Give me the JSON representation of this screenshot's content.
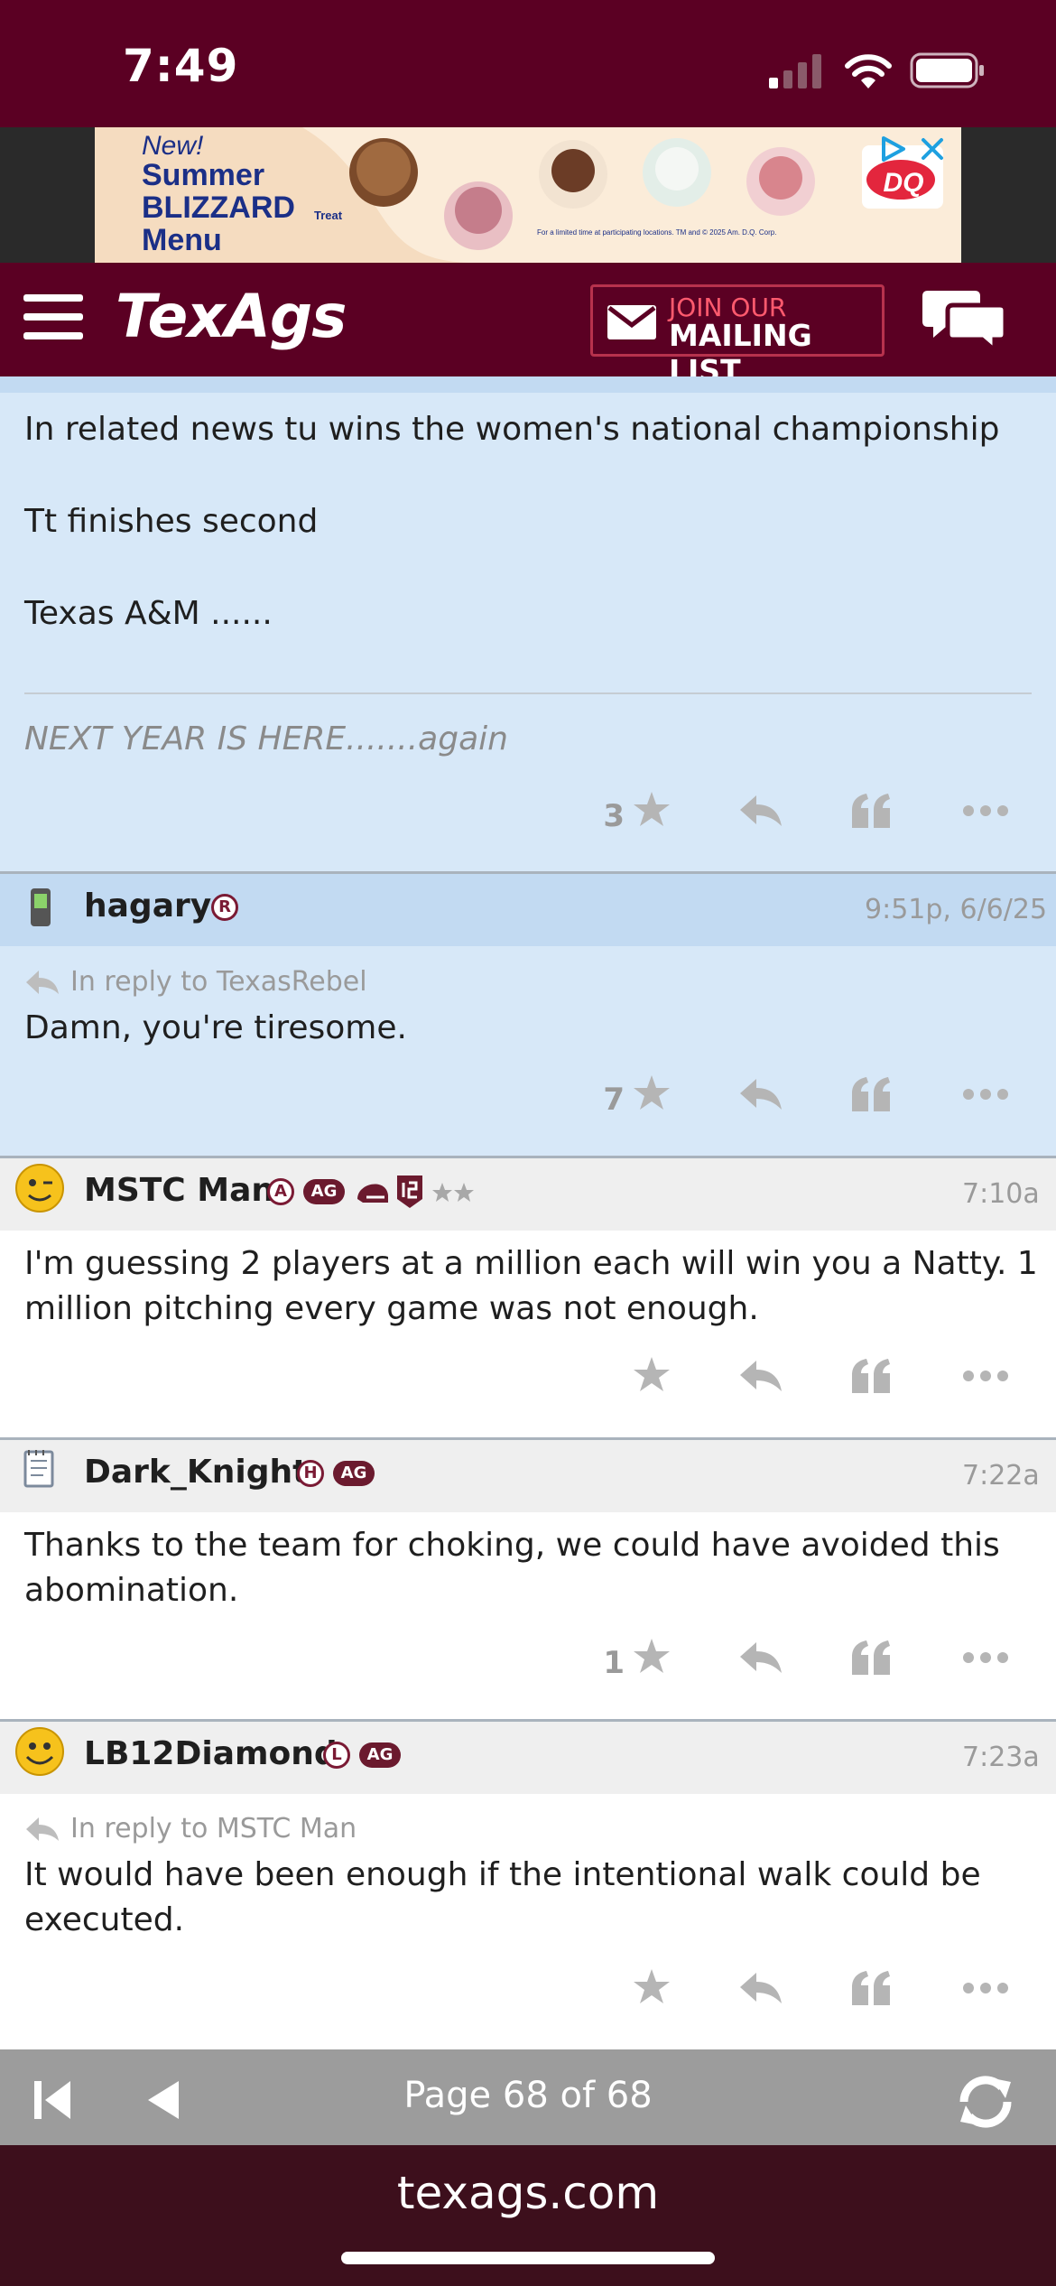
{
  "status_bar": {
    "time": "7:49"
  },
  "ad": {
    "line1": "New!",
    "line2": "Summer",
    "line3": "BLIZZARD",
    "line3b": "Treat",
    "line4": "Menu",
    "brand": "DQ",
    "fineprint": "For a limited time at participating locations. TM and © 2025 Am. D.Q. Corp."
  },
  "header": {
    "logo": "TexAgs",
    "mailing_line1": "JOIN OUR",
    "mailing_line2": "MAILING LIST"
  },
  "posts": [
    {
      "lines": [
        "In related news tu wins the women's national championship",
        "Tt finishes second",
        "Texas A&M ......"
      ],
      "signature": "NEXT YEAR IS HERE.......again",
      "likes": "3"
    },
    {
      "username": "hagary",
      "badge": "R",
      "timestamp": "9:51p, 6/6/25",
      "reply_to": "In reply to TexasRebel",
      "lines": [
        "Damn, you're tiresome."
      ],
      "likes": "7"
    },
    {
      "username": "MSTC Man",
      "badge": "A",
      "ag": "AG",
      "timestamp": "7:10a",
      "lines": [
        "I'm guessing 2 players at a million each will win you a Natty. 1",
        "million pitching every game was not enough."
      ],
      "likes": ""
    },
    {
      "username": "Dark_Knight",
      "badge": "H",
      "ag": "AG",
      "timestamp": "7:22a",
      "lines": [
        "Thanks to the team for choking, we could have avoided this",
        "abomination."
      ],
      "likes": "1"
    },
    {
      "username": "LB12Diamond",
      "badge": "L",
      "ag": "AG",
      "timestamp": "7:23a",
      "reply_to": "In reply to MSTC Man",
      "lines": [
        "It would have been enough if the intentional walk could be",
        "executed."
      ],
      "likes": ""
    }
  ],
  "pager": {
    "label": "Page 68 of 68"
  },
  "browser": {
    "url": "texags.com"
  },
  "colors": {
    "maroon": "#5b0023",
    "post_blue": "#d7e8f8",
    "meta_blue": "#c2daf2",
    "icon_gray": "#b5b5b5"
  }
}
